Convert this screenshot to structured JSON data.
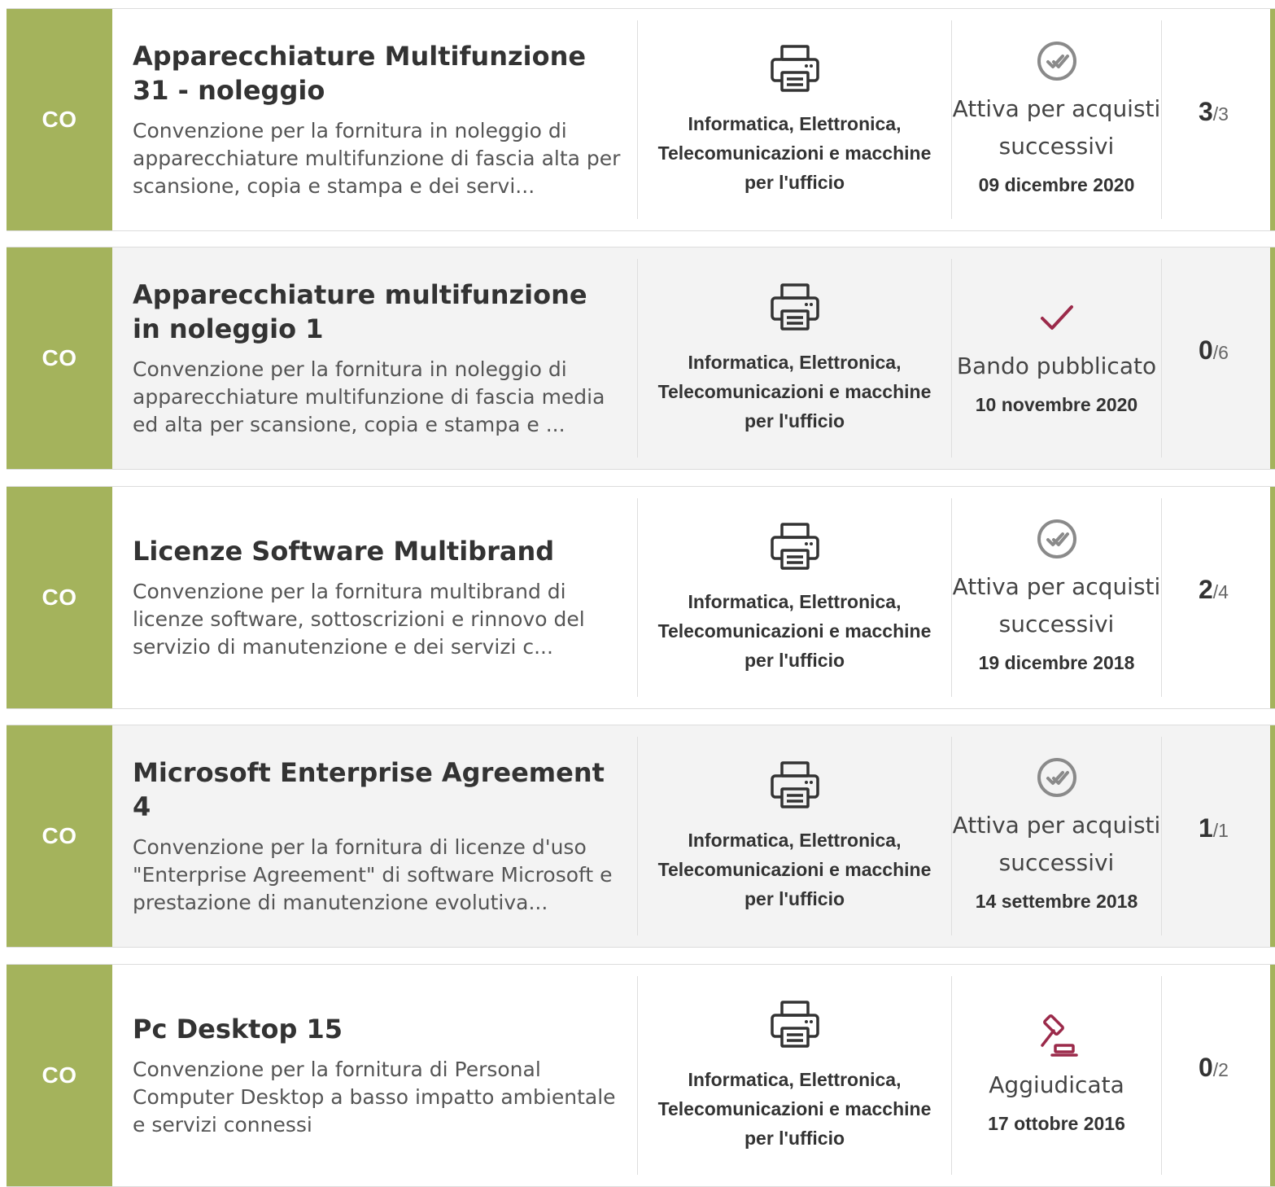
{
  "colors": {
    "badge": "#a4b35c",
    "accent": "#9b2a4a",
    "icon_gray": "#8a8a8a"
  },
  "rows": [
    {
      "badge": "CO",
      "title": "Apparecchiature Multifunzione 31 - noleggio",
      "description": "Convenzione per la fornitura in noleggio di apparecchiature multifunzione di fascia alta per scansione, copia e stampa e dei servi...",
      "category_icon": "printer-icon",
      "category": "Informatica, Elettronica, Telecomunicazioni e macchine per l'ufficio",
      "status_icon": "double-check-circle-icon",
      "status": "Attiva per acquisti successivi",
      "date": "09 dicembre 2020",
      "count": "3",
      "total": "/3"
    },
    {
      "badge": "CO",
      "title": "Apparecchiature multifunzione in noleggio 1",
      "description": "Convenzione per la fornitura in noleggio di apparecchiature multifunzione di fascia media ed alta per scansione, copia e stampa e ...",
      "category_icon": "printer-icon",
      "category": "Informatica, Elettronica, Telecomunicazioni e macchine per l'ufficio",
      "status_icon": "check-icon",
      "status": "Bando pubblicato",
      "date": "10 novembre 2020",
      "count": "0",
      "total": "/6"
    },
    {
      "badge": "CO",
      "title": "Licenze Software Multibrand",
      "description": "Convenzione per la fornitura multibrand di licenze software, sottoscrizioni e rinnovo del servizio di manutenzione e dei servizi c...",
      "category_icon": "printer-icon",
      "category": "Informatica, Elettronica, Telecomunicazioni e macchine per l'ufficio",
      "status_icon": "double-check-circle-icon",
      "status": "Attiva per acquisti successivi",
      "date": "19 dicembre 2018",
      "count": "2",
      "total": "/4"
    },
    {
      "badge": "CO",
      "title": "Microsoft Enterprise Agreement 4",
      "description": "Convenzione per la fornitura di licenze d'uso \"Enterprise Agreement\" di software Microsoft e prestazione di manutenzione evolutiva...",
      "category_icon": "printer-icon",
      "category": "Informatica, Elettronica, Telecomunicazioni e macchine per l'ufficio",
      "status_icon": "double-check-circle-icon",
      "status": "Attiva per acquisti successivi",
      "date": "14 settembre 2018",
      "count": "1",
      "total": "/1"
    },
    {
      "badge": "CO",
      "title": "Pc Desktop 15",
      "description": "Convenzione per la fornitura di Personal Computer Desktop a basso impatto ambientale e servizi connessi",
      "category_icon": "printer-icon",
      "category": "Informatica, Elettronica, Telecomunicazioni e macchine per l'ufficio",
      "status_icon": "gavel-icon",
      "status": "Aggiudicata",
      "date": "17 ottobre 2016",
      "count": "0",
      "total": "/2"
    }
  ]
}
